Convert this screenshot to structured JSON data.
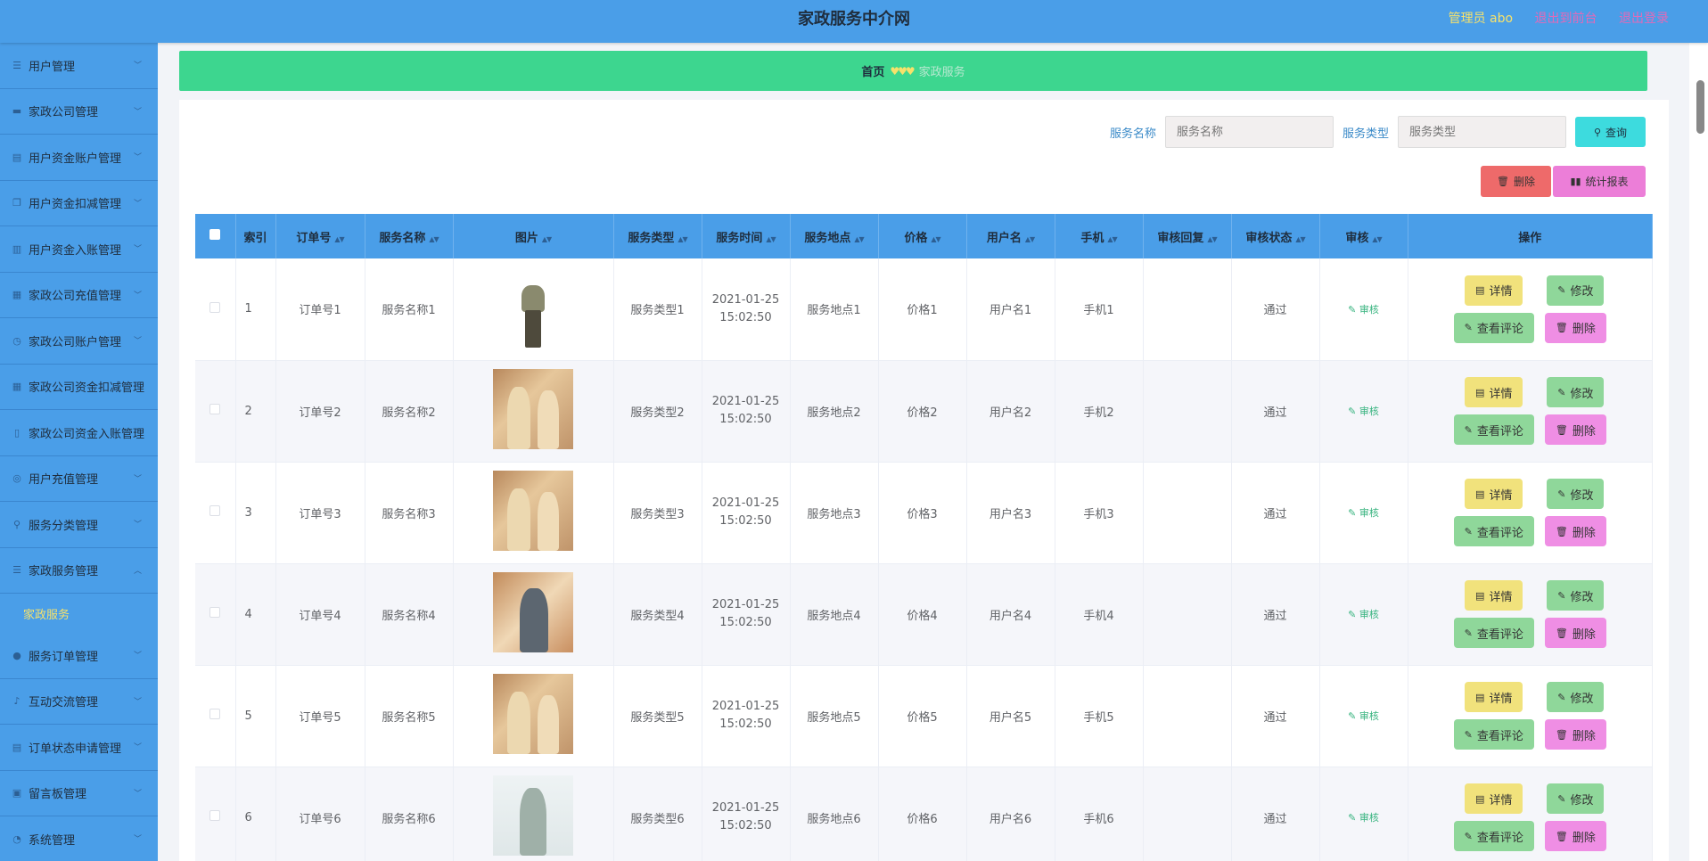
{
  "header": {
    "title": "家政服务中介网",
    "admin": "管理员 abo",
    "to_front": "退出到前台",
    "logout": "退出登录"
  },
  "sidebar": {
    "items": [
      {
        "label": "用户管理",
        "icon": "list-icon"
      },
      {
        "label": "家政公司管理",
        "icon": "monitor-icon"
      },
      {
        "label": "用户资金账户管理",
        "icon": "clipboard-icon"
      },
      {
        "label": "用户资金扣减管理",
        "icon": "copy-icon"
      },
      {
        "label": "用户资金入账管理",
        "icon": "bank-icon"
      },
      {
        "label": "家政公司充值管理",
        "icon": "card-icon"
      },
      {
        "label": "家政公司账户管理",
        "icon": "clock-icon"
      },
      {
        "label": "家政公司资金扣减管理",
        "icon": "grid-icon"
      },
      {
        "label": "家政公司资金入账管理",
        "icon": "phone-icon"
      },
      {
        "label": "用户充值管理",
        "icon": "target-icon"
      },
      {
        "label": "服务分类管理",
        "icon": "search-icon"
      },
      {
        "label": "家政服务管理",
        "icon": "list-icon"
      },
      {
        "label": "服务订单管理",
        "icon": "pin-icon"
      },
      {
        "label": "互动交流管理",
        "icon": "mic-icon"
      },
      {
        "label": "订单状态申请管理",
        "icon": "clipboard-icon"
      },
      {
        "label": "留言板管理",
        "icon": "window-icon"
      },
      {
        "label": "系统管理",
        "icon": "compass-icon"
      }
    ],
    "active_sub": "家政服务"
  },
  "breadcrumb": {
    "home": "首页",
    "separator": "♥♥♥",
    "current": "家政服务"
  },
  "search": {
    "name_label": "服务名称",
    "name_placeholder": "服务名称",
    "type_label": "服务类型",
    "type_placeholder": "服务类型",
    "query_label": "查询"
  },
  "toolbar": {
    "delete_label": "删除",
    "stat_label": "统计报表"
  },
  "table": {
    "headers": [
      "索引",
      "订单号",
      "服务名称",
      "图片",
      "服务类型",
      "服务时间",
      "服务地点",
      "价格",
      "用户名",
      "手机",
      "审核回复",
      "审核状态",
      "审核",
      "操作"
    ],
    "rows": [
      {
        "idx": "1",
        "order": "订单号1",
        "name": "服务名称1",
        "type": "服务类型1",
        "time": "2021-01-25 15:02:50",
        "place": "服务地点1",
        "price": "价格1",
        "user": "用户名1",
        "phone": "手机1",
        "reply": "",
        "status": "通过",
        "audit": "审核"
      },
      {
        "idx": "2",
        "order": "订单号2",
        "name": "服务名称2",
        "type": "服务类型2",
        "time": "2021-01-25 15:02:50",
        "place": "服务地点2",
        "price": "价格2",
        "user": "用户名2",
        "phone": "手机2",
        "reply": "",
        "status": "通过",
        "audit": "审核"
      },
      {
        "idx": "3",
        "order": "订单号3",
        "name": "服务名称3",
        "type": "服务类型3",
        "time": "2021-01-25 15:02:50",
        "place": "服务地点3",
        "price": "价格3",
        "user": "用户名3",
        "phone": "手机3",
        "reply": "",
        "status": "通过",
        "audit": "审核"
      },
      {
        "idx": "4",
        "order": "订单号4",
        "name": "服务名称4",
        "type": "服务类型4",
        "time": "2021-01-25 15:02:50",
        "place": "服务地点4",
        "price": "价格4",
        "user": "用户名4",
        "phone": "手机4",
        "reply": "",
        "status": "通过",
        "audit": "审核"
      },
      {
        "idx": "5",
        "order": "订单号5",
        "name": "服务名称5",
        "type": "服务类型5",
        "time": "2021-01-25 15:02:50",
        "place": "服务地点5",
        "price": "价格5",
        "user": "用户名5",
        "phone": "手机5",
        "reply": "",
        "status": "通过",
        "audit": "审核"
      },
      {
        "idx": "6",
        "order": "订单号6",
        "name": "服务名称6",
        "type": "服务类型6",
        "time": "2021-01-25 15:02:50",
        "place": "服务地点6",
        "price": "价格6",
        "user": "用户名6",
        "phone": "手机6",
        "reply": "",
        "status": "通过",
        "audit": "审核"
      }
    ],
    "ops": {
      "detail": "详情",
      "edit": "修改",
      "comment": "查看评论",
      "remove": "删除"
    }
  },
  "colors": {
    "header_bg": "#4a9ee8",
    "breadcrumb_bg": "#3dd68f",
    "admin_text": "#f7e26b",
    "link_text": "#e26ab8"
  }
}
